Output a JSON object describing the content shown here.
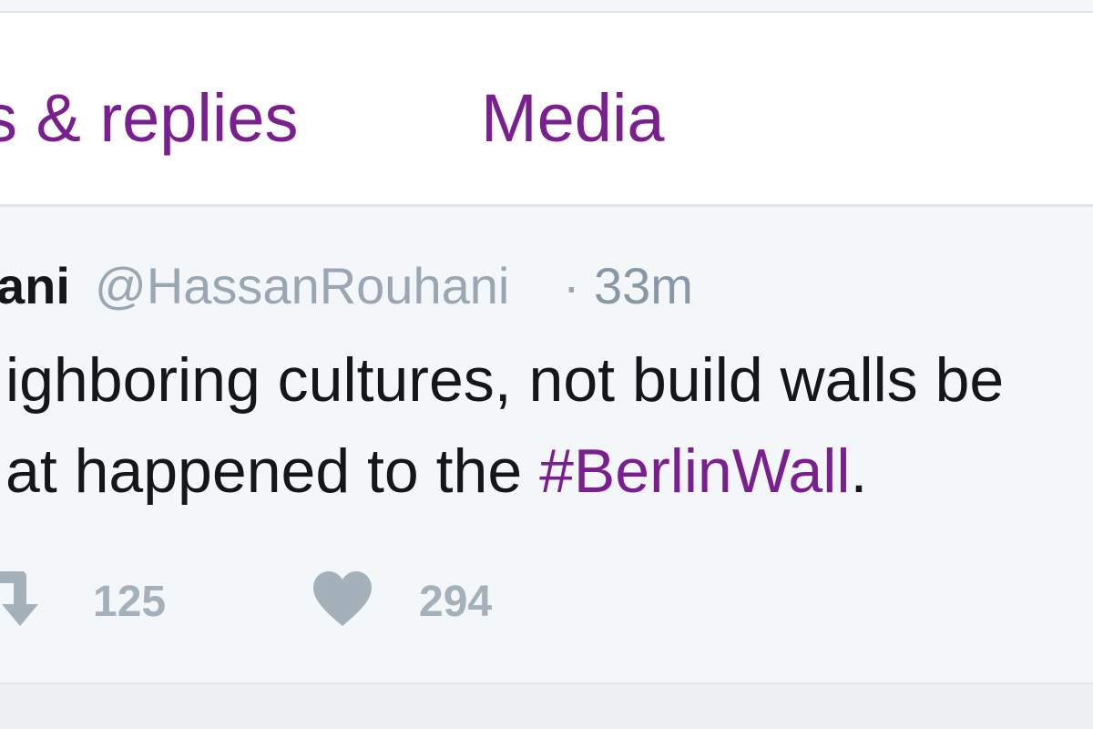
{
  "tabs": {
    "tweets_replies_label": "s & replies",
    "media_label": "Media"
  },
  "tweet": {
    "author_name": "ani",
    "author_handle": "@HassanRouhani",
    "separator": "·",
    "time": "33m",
    "text_line1": "ighboring cultures, not build walls be",
    "text_line2_prefix": "at happened to the ",
    "hashtag": "#BerlinWall",
    "text_line2_suffix": ".",
    "retweet_count": "125",
    "like_count": "294"
  },
  "colors": {
    "accent": "#7a1f8f",
    "text": "#14171a",
    "muted": "#9aa7b2",
    "tweet_bg": "#f4f7f9"
  },
  "icons": {
    "retweet": "retweet-icon",
    "like": "heart-icon"
  }
}
